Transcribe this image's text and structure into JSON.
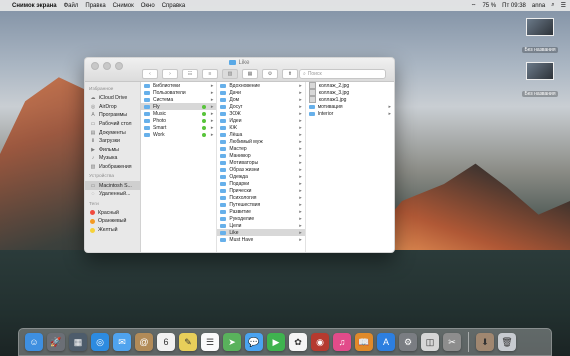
{
  "menubar": {
    "apple": "",
    "app": "Снимок экрана",
    "menus": [
      "Файл",
      "Правка",
      "Снимок",
      "Окно",
      "Справка"
    ],
    "battery": "75 %",
    "clock": "Пт 09:38",
    "user": "anna"
  },
  "desktop": {
    "items": [
      {
        "label": "Без названия"
      },
      {
        "label": "Без названия"
      }
    ]
  },
  "window": {
    "title": "Like",
    "search_placeholder": "Поиск",
    "toolbar": {
      "back": "‹",
      "forward": "›",
      "view_icon": "☷",
      "view_list": "≡",
      "view_columns": "▥",
      "view_cover": "▦",
      "arrange": "⚙",
      "action": "⬆",
      "tag": "○"
    },
    "sidebar": {
      "favorites_title": "Избранное",
      "favorites": [
        {
          "icon": "☁",
          "label": "iCloud Drive"
        },
        {
          "icon": "◎",
          "label": "AirDrop"
        },
        {
          "icon": "A",
          "label": "Программы"
        },
        {
          "icon": "▭",
          "label": "Рабочий стол"
        },
        {
          "icon": "▤",
          "label": "Документы"
        },
        {
          "icon": "⬇",
          "label": "Загрузки"
        },
        {
          "icon": "▶",
          "label": "Фильмы"
        },
        {
          "icon": "♪",
          "label": "Музыка"
        },
        {
          "icon": "▧",
          "label": "Изображения"
        }
      ],
      "devices_title": "Устройства",
      "devices": [
        {
          "icon": "▭",
          "label": "Macintosh S..."
        },
        {
          "icon": "◌",
          "label": "Удаленный..."
        }
      ],
      "tags_title": "Теги",
      "tags": [
        {
          "color": "#f14a3e",
          "label": "Красный"
        },
        {
          "color": "#f59a23",
          "label": "Оранжевый"
        },
        {
          "color": "#f6d23a",
          "label": "Желтый"
        }
      ]
    },
    "col1": [
      {
        "label": "Библиотеки",
        "sel": false,
        "dot": false
      },
      {
        "label": "Пользователи",
        "sel": false,
        "dot": false
      },
      {
        "label": "Система",
        "sel": false,
        "dot": false
      },
      {
        "label": "Fly",
        "sel": true,
        "dot": true
      },
      {
        "label": "Music",
        "sel": false,
        "dot": true
      },
      {
        "label": "Photo",
        "sel": false,
        "dot": true
      },
      {
        "label": "Smart",
        "sel": false,
        "dot": true
      },
      {
        "label": "Work",
        "sel": false,
        "dot": true
      }
    ],
    "col2": [
      {
        "label": "Вдохновение",
        "sel": false
      },
      {
        "label": "Дачи",
        "sel": false
      },
      {
        "label": "Дом",
        "sel": false
      },
      {
        "label": "Досуг",
        "sel": false
      },
      {
        "label": "ЗОЖ",
        "sel": false
      },
      {
        "label": "Идеи",
        "sel": false
      },
      {
        "label": "КЖ",
        "sel": false
      },
      {
        "label": "Лёша",
        "sel": false
      },
      {
        "label": "Любимый муж",
        "sel": false
      },
      {
        "label": "Мастер",
        "sel": false
      },
      {
        "label": "Маникюр",
        "sel": false
      },
      {
        "label": "Мотиваторы",
        "sel": false
      },
      {
        "label": "Образ жизни",
        "sel": false
      },
      {
        "label": "Одежда",
        "sel": false
      },
      {
        "label": "Подарки",
        "sel": false
      },
      {
        "label": "Прически",
        "sel": false
      },
      {
        "label": "Психология",
        "sel": false
      },
      {
        "label": "Путешествия",
        "sel": false
      },
      {
        "label": "Развитие",
        "sel": false
      },
      {
        "label": "Рукоделие",
        "sel": false
      },
      {
        "label": "Цели",
        "sel": false
      },
      {
        "label": "Like",
        "sel": true
      },
      {
        "label": "Must Have",
        "sel": false
      }
    ],
    "col3": [
      {
        "label": "коллаж_2.jpg",
        "kind": "img"
      },
      {
        "label": "коллаж_3.jpg",
        "kind": "img"
      },
      {
        "label": "коллаж1.jpg",
        "kind": "img"
      },
      {
        "label": "мотивация",
        "kind": "folder"
      },
      {
        "label": "Interior",
        "kind": "folder"
      }
    ]
  },
  "dock": {
    "apps": [
      {
        "name": "finder",
        "glyph": "☺",
        "color": "#3e8fe0"
      },
      {
        "name": "launchpad",
        "glyph": "🚀",
        "color": "#6b6f76"
      },
      {
        "name": "mission-control",
        "glyph": "▦",
        "color": "#4d5c6b"
      },
      {
        "name": "safari",
        "glyph": "◎",
        "color": "#2d8be0"
      },
      {
        "name": "mail",
        "glyph": "✉",
        "color": "#4fa3ee"
      },
      {
        "name": "contacts",
        "glyph": "@",
        "color": "#b28b58"
      },
      {
        "name": "calendar",
        "glyph": "6",
        "color": "#f2f2f2"
      },
      {
        "name": "notes",
        "glyph": "✎",
        "color": "#e8cf5a"
      },
      {
        "name": "reminders",
        "glyph": "☰",
        "color": "#fafafa"
      },
      {
        "name": "maps",
        "glyph": "➤",
        "color": "#59b25c"
      },
      {
        "name": "messages",
        "glyph": "💬",
        "color": "#4aa3f0"
      },
      {
        "name": "facetime",
        "glyph": "▶",
        "color": "#3fb34f"
      },
      {
        "name": "photos",
        "glyph": "✿",
        "color": "#f5f5f5"
      },
      {
        "name": "photo-booth",
        "glyph": "◉",
        "color": "#b53a2f"
      },
      {
        "name": "itunes",
        "glyph": "♫",
        "color": "#e24b8a"
      },
      {
        "name": "ibooks",
        "glyph": "📖",
        "color": "#e08a2a"
      },
      {
        "name": "app-store",
        "glyph": "A",
        "color": "#2d7fe0"
      },
      {
        "name": "system-preferences",
        "glyph": "⚙",
        "color": "#7a7d82"
      },
      {
        "name": "preview",
        "glyph": "◫",
        "color": "#d6d6d6"
      },
      {
        "name": "photoshop-like",
        "glyph": "✂",
        "color": "#8d8d8d"
      }
    ],
    "right": [
      {
        "name": "downloads-stack",
        "glyph": "⬇",
        "color": "#a08770"
      },
      {
        "name": "trash",
        "glyph": "🗑",
        "color": "#c7cbd0"
      }
    ]
  }
}
